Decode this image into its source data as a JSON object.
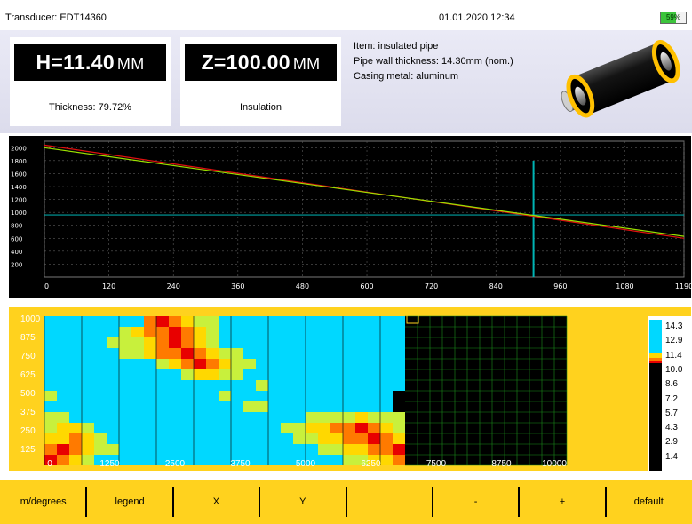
{
  "status": {
    "transducer": "Transducer: EDT14360",
    "datetime": "01.01.2020 12:34",
    "battery_percent": 59,
    "battery_label": "59%"
  },
  "measurements": {
    "h": {
      "value": "H=11.40",
      "unit": "MM",
      "caption": "Thickness: 79.72%"
    },
    "z": {
      "value": "Z=100.00",
      "unit": "MM",
      "caption": "Insulation"
    }
  },
  "info": {
    "item": "Item: insulated pipe",
    "wall_thickness": "Pipe wall thickness: 14.30mm (nom.)",
    "casing_metal": "Casing metal: aluminum"
  },
  "ascan": {
    "y_ticks": [
      "200",
      "400",
      "600",
      "800",
      "1000",
      "1200",
      "1400",
      "1600",
      "1800",
      "2000"
    ],
    "x_ticks": [
      "0",
      "120",
      "240",
      "360",
      "480",
      "600",
      "720",
      "840",
      "960",
      "1080",
      "1190"
    ],
    "x_range": [
      0,
      1190
    ],
    "y_range": [
      0,
      2100
    ],
    "series_green": [
      [
        0,
        2000
      ],
      [
        1190,
        630
      ]
    ],
    "series_red": [
      [
        0,
        2040
      ],
      [
        1190,
        600
      ]
    ],
    "gate_y": 960,
    "cursor_x": 910,
    "colors": {
      "green": "#9be000",
      "red": "#e01010",
      "gate": "#00a0a0",
      "cursor": "#00b4b4",
      "grid": "#5a5a5a"
    }
  },
  "cscan": {
    "x_ticks": [
      "0",
      "1250",
      "2500",
      "3750",
      "5000",
      "6250",
      "7500",
      "8750",
      "10000"
    ],
    "y_ticks": [
      "1000",
      "875",
      "750",
      "625",
      "500",
      "375",
      "250",
      "125"
    ],
    "cols": 42,
    "rows": 14,
    "filled_cols": 29,
    "hot_cells": [
      [
        8,
        0,
        1
      ],
      [
        9,
        0,
        0
      ],
      [
        10,
        0,
        1
      ],
      [
        11,
        0,
        2
      ],
      [
        12,
        0,
        3
      ],
      [
        13,
        0,
        3
      ],
      [
        6,
        1,
        3
      ],
      [
        7,
        1,
        2
      ],
      [
        8,
        1,
        1
      ],
      [
        9,
        1,
        1
      ],
      [
        10,
        1,
        0
      ],
      [
        11,
        1,
        1
      ],
      [
        12,
        1,
        2
      ],
      [
        13,
        1,
        3
      ],
      [
        5,
        2,
        3
      ],
      [
        6,
        2,
        3
      ],
      [
        7,
        2,
        3
      ],
      [
        8,
        2,
        2
      ],
      [
        9,
        2,
        1
      ],
      [
        10,
        2,
        0
      ],
      [
        11,
        2,
        1
      ],
      [
        12,
        2,
        2
      ],
      [
        13,
        2,
        3
      ],
      [
        6,
        3,
        3
      ],
      [
        7,
        3,
        3
      ],
      [
        8,
        3,
        2
      ],
      [
        9,
        3,
        1
      ],
      [
        10,
        3,
        1
      ],
      [
        11,
        3,
        0
      ],
      [
        12,
        3,
        1
      ],
      [
        13,
        3,
        2
      ],
      [
        14,
        3,
        3
      ],
      [
        15,
        3,
        3
      ],
      [
        9,
        4,
        3
      ],
      [
        10,
        4,
        2
      ],
      [
        11,
        4,
        1
      ],
      [
        12,
        4,
        0
      ],
      [
        13,
        4,
        1
      ],
      [
        14,
        4,
        2
      ],
      [
        15,
        4,
        3
      ],
      [
        16,
        4,
        3
      ],
      [
        11,
        5,
        3
      ],
      [
        12,
        5,
        2
      ],
      [
        13,
        5,
        2
      ],
      [
        14,
        5,
        3
      ],
      [
        15,
        5,
        3
      ],
      [
        17,
        6,
        3
      ],
      [
        0,
        7,
        3
      ],
      [
        14,
        7,
        3
      ],
      [
        16,
        8,
        3
      ],
      [
        17,
        8,
        3
      ],
      [
        0,
        9,
        3
      ],
      [
        1,
        9,
        3
      ],
      [
        21,
        9,
        3
      ],
      [
        22,
        9,
        3
      ],
      [
        23,
        9,
        3
      ],
      [
        24,
        9,
        3
      ],
      [
        25,
        9,
        2
      ],
      [
        26,
        9,
        3
      ],
      [
        27,
        9,
        3
      ],
      [
        28,
        9,
        3
      ],
      [
        0,
        10,
        3
      ],
      [
        1,
        10,
        2
      ],
      [
        2,
        10,
        2
      ],
      [
        3,
        10,
        3
      ],
      [
        19,
        10,
        3
      ],
      [
        20,
        10,
        3
      ],
      [
        21,
        10,
        2
      ],
      [
        22,
        10,
        2
      ],
      [
        23,
        10,
        1
      ],
      [
        24,
        10,
        1
      ],
      [
        25,
        10,
        0
      ],
      [
        26,
        10,
        1
      ],
      [
        27,
        10,
        2
      ],
      [
        28,
        10,
        3
      ],
      [
        0,
        11,
        2
      ],
      [
        1,
        11,
        2
      ],
      [
        2,
        11,
        1
      ],
      [
        3,
        11,
        2
      ],
      [
        4,
        11,
        3
      ],
      [
        20,
        11,
        3
      ],
      [
        21,
        11,
        3
      ],
      [
        22,
        11,
        2
      ],
      [
        23,
        11,
        2
      ],
      [
        24,
        11,
        1
      ],
      [
        25,
        11,
        1
      ],
      [
        26,
        11,
        0
      ],
      [
        27,
        11,
        1
      ],
      [
        28,
        11,
        2
      ],
      [
        0,
        12,
        1
      ],
      [
        1,
        12,
        0
      ],
      [
        2,
        12,
        1
      ],
      [
        3,
        12,
        2
      ],
      [
        4,
        12,
        3
      ],
      [
        5,
        12,
        3
      ],
      [
        22,
        12,
        3
      ],
      [
        23,
        12,
        3
      ],
      [
        24,
        12,
        2
      ],
      [
        25,
        12,
        2
      ],
      [
        26,
        12,
        1
      ],
      [
        27,
        12,
        1
      ],
      [
        28,
        12,
        0
      ],
      [
        0,
        13,
        0
      ],
      [
        1,
        13,
        1
      ],
      [
        2,
        13,
        2
      ],
      [
        3,
        13,
        3
      ],
      [
        24,
        13,
        3
      ],
      [
        25,
        13,
        3
      ],
      [
        26,
        13,
        2
      ],
      [
        27,
        13,
        2
      ],
      [
        28,
        13,
        1
      ]
    ],
    "notch_cells": [
      [
        28,
        7
      ],
      [
        29,
        7
      ],
      [
        28,
        8
      ],
      [
        29,
        8
      ]
    ],
    "heat_colors": [
      "#e80000",
      "#ff7a00",
      "#ffd800",
      "#c8f03c"
    ],
    "base_color": "#00d8ff",
    "empty_color": "#000000",
    "grid_color": "#1a8c1a"
  },
  "legend": {
    "labels": [
      "14.3",
      "12.9",
      "11.4",
      "10.0",
      "8.6",
      "7.2",
      "5.7",
      "4.3",
      "2.9",
      "1.4"
    ]
  },
  "toolbar": {
    "buttons": [
      {
        "id": "m-degrees",
        "label": "m/degrees"
      },
      {
        "id": "legend",
        "label": "legend"
      },
      {
        "id": "x",
        "label": "X"
      },
      {
        "id": "y",
        "label": "Y"
      },
      {
        "id": "blank",
        "label": ""
      },
      {
        "id": "minus",
        "label": "-"
      },
      {
        "id": "plus",
        "label": "+"
      },
      {
        "id": "default",
        "label": "default"
      }
    ]
  }
}
